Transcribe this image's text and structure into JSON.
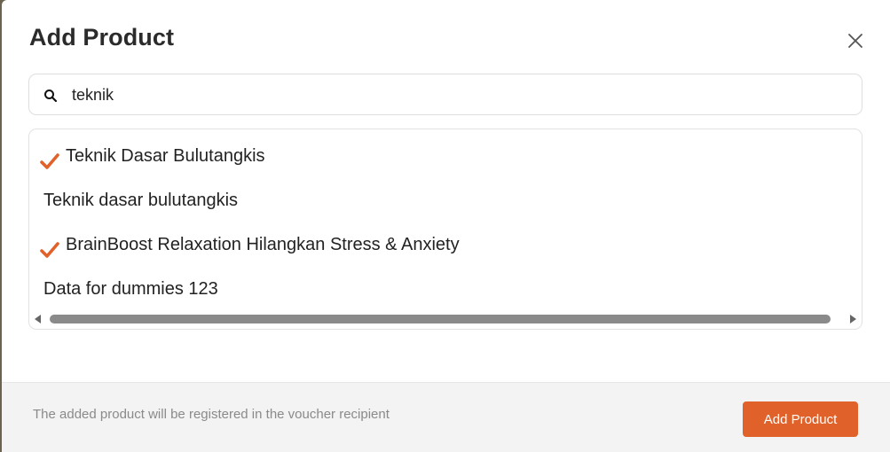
{
  "modal": {
    "title": "Add Product",
    "close_icon": "close-icon"
  },
  "search": {
    "icon": "search-icon",
    "value": "teknik"
  },
  "results": [
    {
      "label": "Teknik Dasar Bulutangkis",
      "selected": true
    },
    {
      "label": "Teknik dasar bulutangkis",
      "selected": false
    },
    {
      "label": "BrainBoost Relaxation Hilangkan Stress & Anxiety",
      "selected": true
    },
    {
      "label": "Data for dummies 123",
      "selected": false
    }
  ],
  "footer": {
    "note": "The added product will be registered in the voucher recipient",
    "add_button_label": "Add Product"
  },
  "colors": {
    "accent": "#e0622a",
    "check": "#e0622a"
  }
}
